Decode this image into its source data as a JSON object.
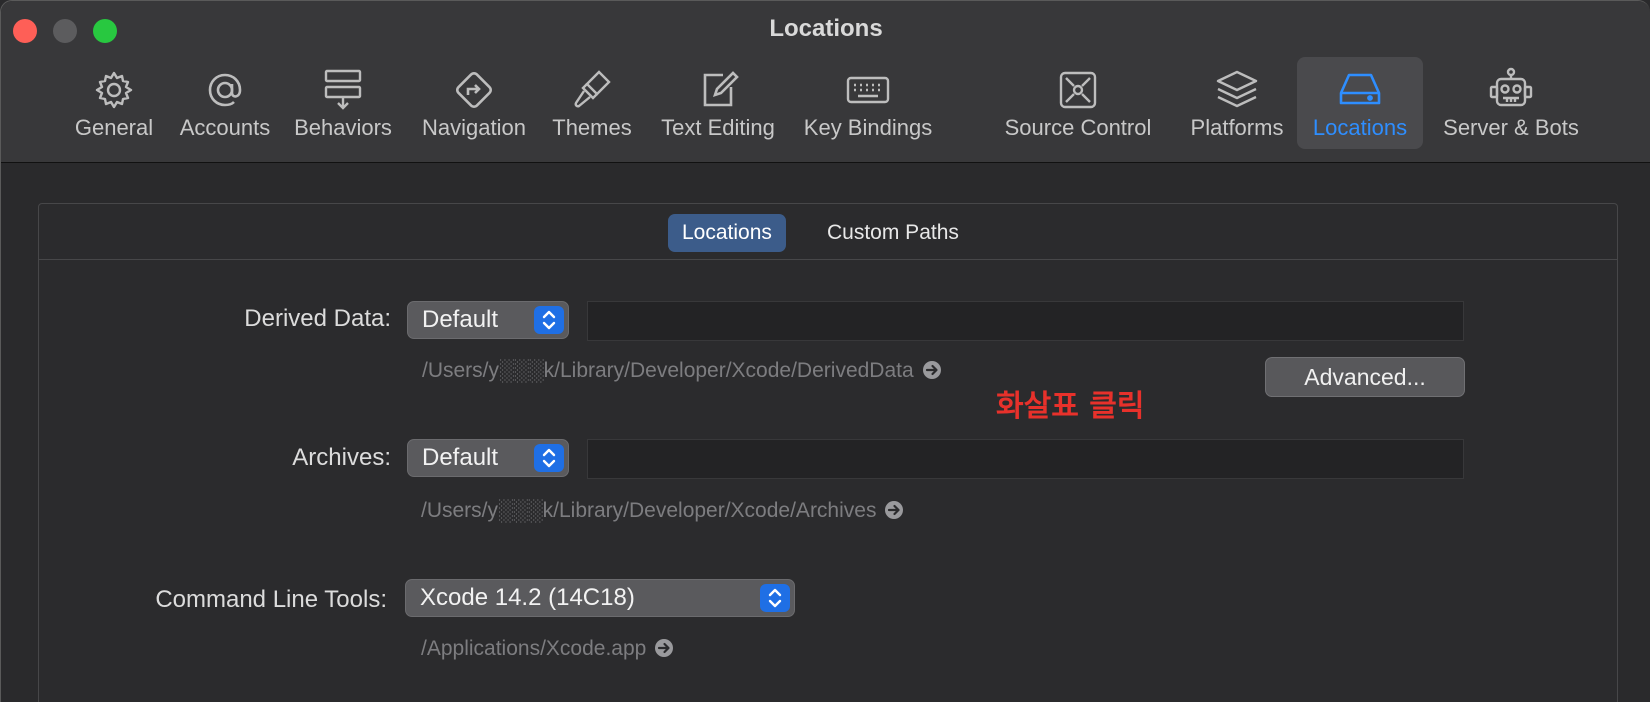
{
  "window": {
    "title": "Locations"
  },
  "toolbar": {
    "items": [
      {
        "label": "General",
        "icon": "gear-icon",
        "active": false
      },
      {
        "label": "Accounts",
        "icon": "at-sign-icon",
        "active": false
      },
      {
        "label": "Behaviors",
        "icon": "behaviors-icon",
        "active": false
      },
      {
        "label": "Navigation",
        "icon": "navigation-icon",
        "active": false
      },
      {
        "label": "Themes",
        "icon": "paintbrush-icon",
        "active": false
      },
      {
        "label": "Text Editing",
        "icon": "edit-icon",
        "active": false
      },
      {
        "label": "Key Bindings",
        "icon": "keyboard-icon",
        "active": false
      },
      {
        "label": "Source Control",
        "icon": "source-control-icon",
        "active": false
      },
      {
        "label": "Platforms",
        "icon": "layers-icon",
        "active": false
      },
      {
        "label": "Locations",
        "icon": "drive-icon",
        "active": true
      },
      {
        "label": "Server & Bots",
        "icon": "robot-icon",
        "active": false
      }
    ],
    "accent": "#2e8eff"
  },
  "tabs": {
    "locations": "Locations",
    "custom_paths": "Custom Paths"
  },
  "derived_data": {
    "label": "Derived Data:",
    "value": "Default",
    "path": "/Users/y░░░k/Library/Developer/Xcode/DerivedData",
    "advanced_button": "Advanced..."
  },
  "annotation": {
    "text": "화살표 클릭",
    "color": "#e8312b"
  },
  "archives": {
    "label": "Archives:",
    "value": "Default",
    "path": "/Users/y░░░k/Library/Developer/Xcode/Archives"
  },
  "command_line_tools": {
    "label": "Command Line Tools:",
    "value": "Xcode 14.2 (14C18)",
    "path": "/Applications/Xcode.app"
  }
}
